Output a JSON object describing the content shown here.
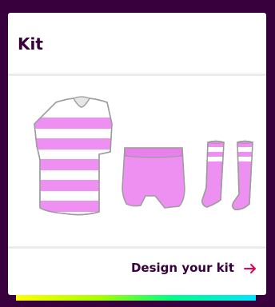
{
  "card": {
    "title": "Kit"
  },
  "kit": {
    "primary_color": "#ee90f2",
    "secondary_color": "#ffffff",
    "outline_color": "#9c9c9c",
    "items": [
      {
        "name": "shirt",
        "pattern": "hoops"
      },
      {
        "name": "shorts",
        "pattern": "plain"
      },
      {
        "name": "socks",
        "pattern": "hoops"
      }
    ]
  },
  "footer": {
    "link_label": "Design your kit",
    "link_icon": "arrow-right-icon",
    "accent_color": "#e90052"
  },
  "colors": {
    "page_background": "#38003c",
    "card_background": "#ffffff",
    "title_color": "#37003c"
  }
}
